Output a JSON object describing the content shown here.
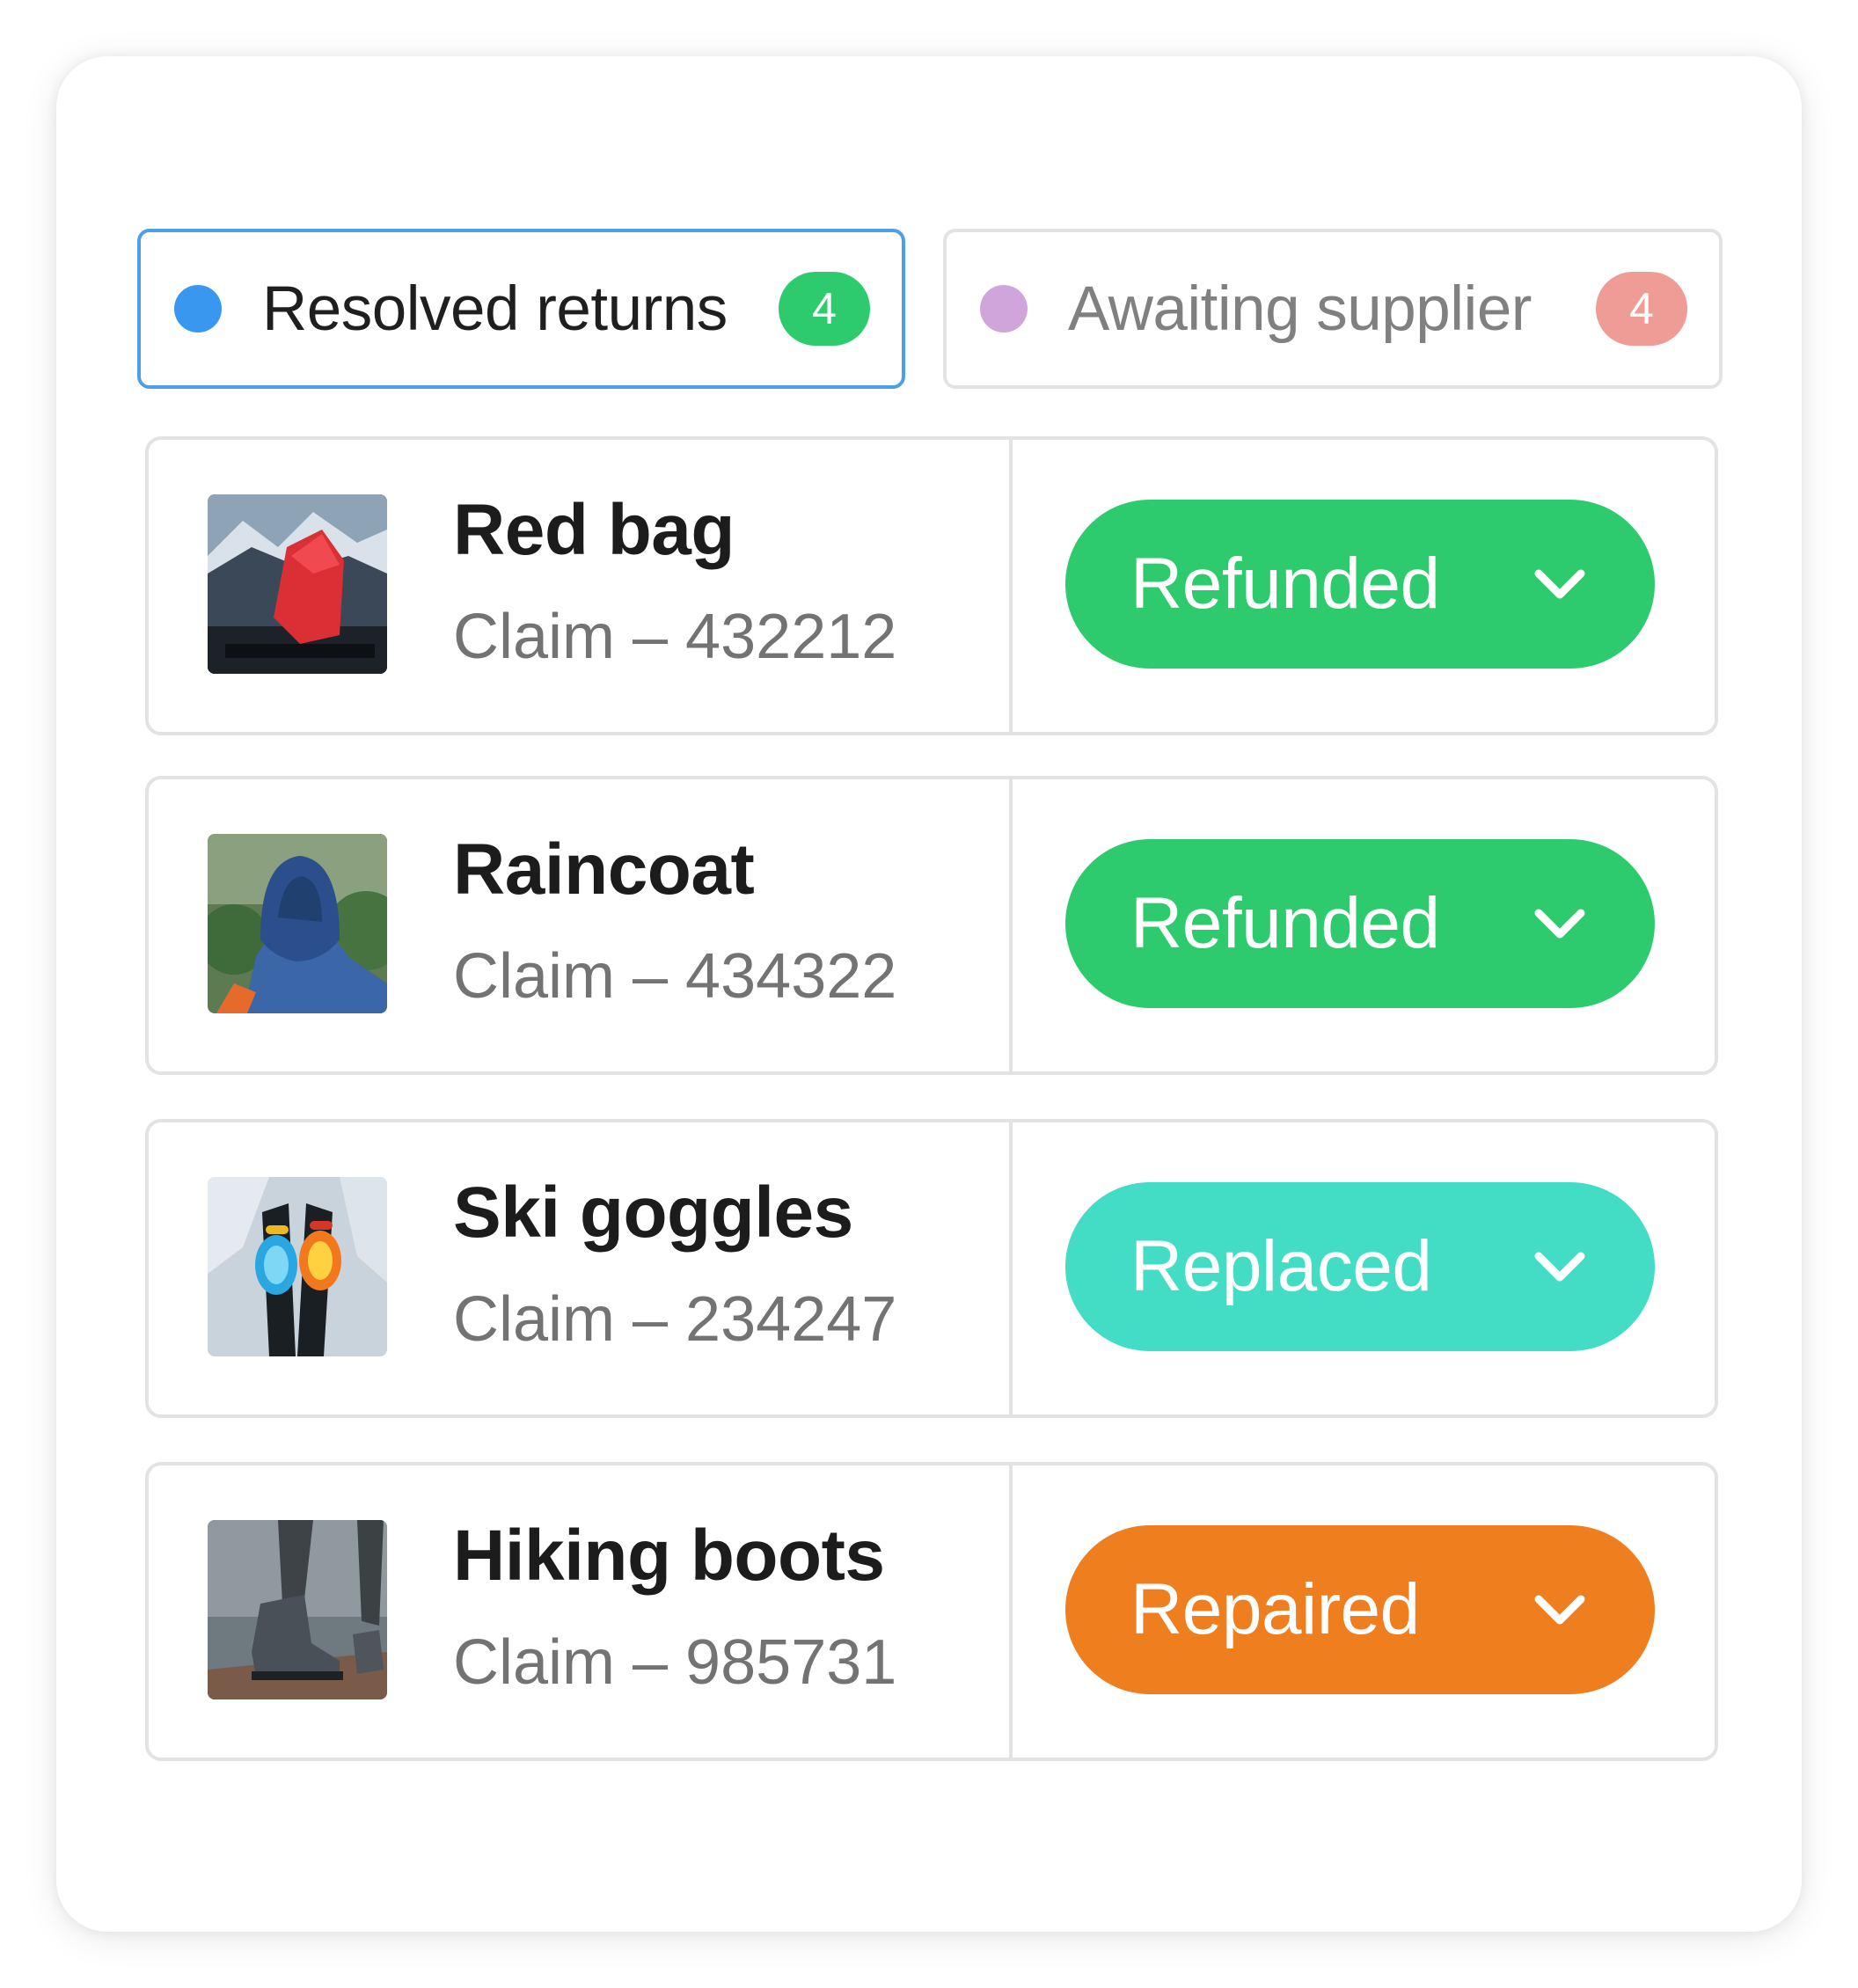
{
  "tabs": [
    {
      "label": "Resolved returns",
      "count": "4",
      "dot_color": "#3a97f0",
      "count_color": "#2ecb6e",
      "active": true
    },
    {
      "label": "Awaiting supplier",
      "count": "4",
      "dot_color": "#cfa5dc",
      "count_color": "#ef9c97",
      "active": false
    }
  ],
  "items": [
    {
      "name": "Red bag",
      "claim": "Claim – 432212",
      "status": "Refunded",
      "status_color": "#2ecb6e",
      "image": "red-bag-photo"
    },
    {
      "name": "Raincoat",
      "claim": "Claim – 434322",
      "status": "Refunded",
      "status_color": "#2ecb6e",
      "image": "raincoat-photo"
    },
    {
      "name": "Ski goggles",
      "claim": "Claim – 234247",
      "status": "Replaced",
      "status_color": "#43dcc5",
      "image": "ski-goggles-photo"
    },
    {
      "name": "Hiking boots",
      "claim": "Claim – 985731",
      "status": "Repaired",
      "status_color": "#ee7e1e",
      "image": "hiking-boots-photo"
    }
  ],
  "icons": {
    "status_dropdown": "chevron-down-icon"
  }
}
